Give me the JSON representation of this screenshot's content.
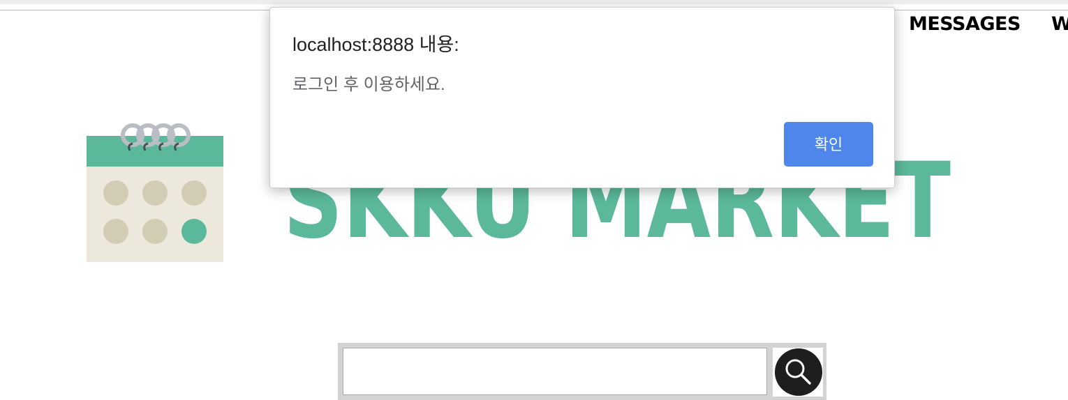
{
  "header": {
    "nav": [
      {
        "label": "MESSAGES"
      },
      {
        "label": "W"
      }
    ]
  },
  "logo": {
    "text": "SKKU MARKET",
    "brand_color": "#5bb89a",
    "icon": "calendar-icon"
  },
  "search": {
    "value": "",
    "button_icon": "search-icon"
  },
  "dialog": {
    "title": "localhost:8888 내용:",
    "message": "로그인 후 이용하세요.",
    "ok_label": "확인",
    "ok_color": "#4f86ec"
  }
}
